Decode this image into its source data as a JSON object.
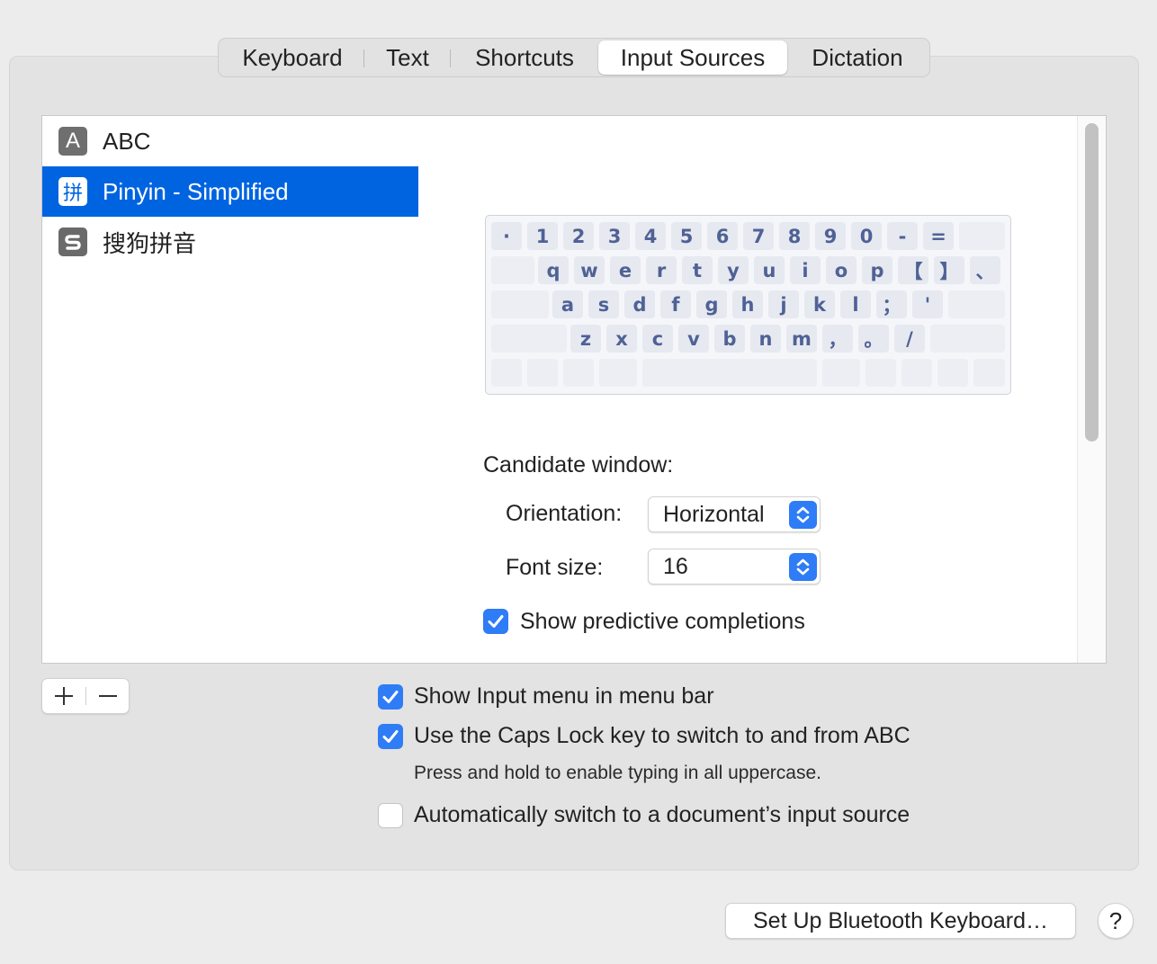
{
  "tabs": [
    {
      "label": "Keyboard",
      "active": false
    },
    {
      "label": "Text",
      "active": false
    },
    {
      "label": "Shortcuts",
      "active": false
    },
    {
      "label": "Input Sources",
      "active": true
    },
    {
      "label": "Dictation",
      "active": false
    }
  ],
  "sources": [
    {
      "icon_glyph": "A",
      "icon": "abc-input-icon",
      "label": "ABC",
      "selected": false
    },
    {
      "icon_glyph": "拼",
      "icon": "pinyin-input-icon",
      "label": "Pinyin - Simplified",
      "selected": true
    },
    {
      "icon_glyph": "S",
      "icon": "sogou-input-icon",
      "label": "搜狗拼音",
      "selected": false
    }
  ],
  "keyboard": {
    "rows": [
      [
        "·",
        "1",
        "2",
        "3",
        "4",
        "5",
        "6",
        "7",
        "8",
        "9",
        "0",
        "-",
        "="
      ],
      [
        "q",
        "w",
        "e",
        "r",
        "t",
        "y",
        "u",
        "i",
        "o",
        "p",
        "【",
        "】",
        "、"
      ],
      [
        "a",
        "s",
        "d",
        "f",
        "g",
        "h",
        "j",
        "k",
        "l",
        "；",
        "'"
      ],
      [
        "z",
        "x",
        "c",
        "v",
        "b",
        "n",
        "m",
        "，",
        "。",
        "/"
      ]
    ]
  },
  "candidate": {
    "heading": "Candidate window:",
    "orientation_label": "Orientation:",
    "orientation_value": "Horizontal",
    "font_size_label": "Font size:",
    "font_size_value": "16",
    "predictive_label": "Show predictive completions",
    "predictive_checked": true
  },
  "options": {
    "show_input_menu": {
      "label": "Show Input menu in menu bar",
      "checked": true
    },
    "caps_lock": {
      "label": "Use the Caps Lock key to switch to and from ABC",
      "checked": true
    },
    "caps_lock_note": "Press and hold to enable typing in all uppercase.",
    "auto_switch": {
      "label": "Automatically switch to a document’s input source",
      "checked": false
    }
  },
  "buttons": {
    "bluetooth": "Set Up Bluetooth Keyboard…",
    "help": "?"
  },
  "colors": {
    "accent": "#2e7cf6",
    "selection": "#0064e1",
    "key_text": "#4f6296"
  }
}
